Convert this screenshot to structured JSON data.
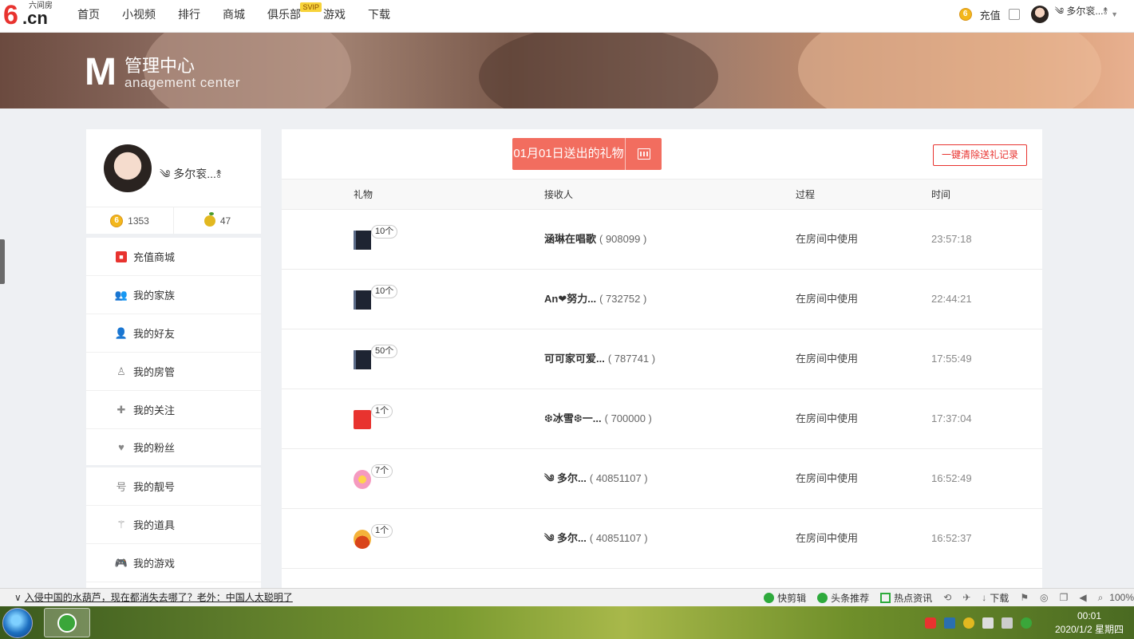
{
  "nav": {
    "logo_six": "6",
    "logo_cn": ".cn",
    "logo_sub": "六间房",
    "items": [
      "首页",
      "小视频",
      "排行",
      "商城",
      "俱乐部",
      "游戏",
      "下载"
    ],
    "svip_badge": "SVIP",
    "coin_glyph": "6",
    "recharge": "充值",
    "username": "༄ 多尔衮...⥉"
  },
  "banner": {
    "m": "M",
    "title": "管理中心",
    "subtitle": "anagement center"
  },
  "sidebar": {
    "name": "༄ 多尔衮...⥉",
    "coins": "1353",
    "beans": "47",
    "menu": [
      {
        "label": "充值商城",
        "icon": "shop-icon"
      },
      {
        "label": "我的家族",
        "icon": "family-icon"
      },
      {
        "label": "我的好友",
        "icon": "friend-icon"
      },
      {
        "label": "我的房管",
        "icon": "room-manager-icon"
      },
      {
        "label": "我的关注",
        "icon": "plus-icon"
      },
      {
        "label": "我的粉丝",
        "icon": "heart-icon"
      },
      {
        "label": "我的靓号",
        "icon": "number-icon"
      },
      {
        "label": "我的道具",
        "icon": "wand-icon"
      },
      {
        "label": "我的游戏",
        "icon": "gamepad-icon"
      }
    ]
  },
  "main": {
    "date_title": "01月01日送出的礼物",
    "clear_button": "一键清除送礼记录",
    "columns": {
      "gift": "礼物",
      "receiver": "接收人",
      "process": "过程",
      "time": "时间"
    },
    "rows": [
      {
        "qty": "10个",
        "receiver": "涵琳在唱歌",
        "rid": "( 908099 )",
        "process": "在房间中使用",
        "time": "23:57:18"
      },
      {
        "qty": "10个",
        "receiver": "An❤努力...",
        "rid": "( 732752 )",
        "process": "在房间中使用",
        "time": "22:44:21"
      },
      {
        "qty": "50个",
        "receiver": "可可家可爱...",
        "rid": "( 787741 )",
        "process": "在房间中使用",
        "time": "17:55:49"
      },
      {
        "qty": "1个",
        "receiver": "❆冰雪❆一...",
        "rid": "( 700000 )",
        "process": "在房间中使用",
        "time": "17:37:04"
      },
      {
        "qty": "7个",
        "receiver": "༄ 多尔...",
        "rid": "( 40851107 )",
        "process": "在房间中使用",
        "time": "16:52:49"
      },
      {
        "qty": "1个",
        "receiver": "༄ 多尔...",
        "rid": "( 40851107 )",
        "process": "在房间中使用",
        "time": "16:52:37"
      }
    ]
  },
  "statusbar": {
    "chevron": "∨",
    "news": "入侵中国的水葫芦，现在都消失去哪了？老外：中国人太聪明了",
    "items": [
      "快剪辑",
      "头条推荐",
      "热点资讯",
      "下载"
    ],
    "zoom": "100%"
  },
  "taskbar": {
    "time": "00:01",
    "date": "2020/1/2 星期四"
  }
}
